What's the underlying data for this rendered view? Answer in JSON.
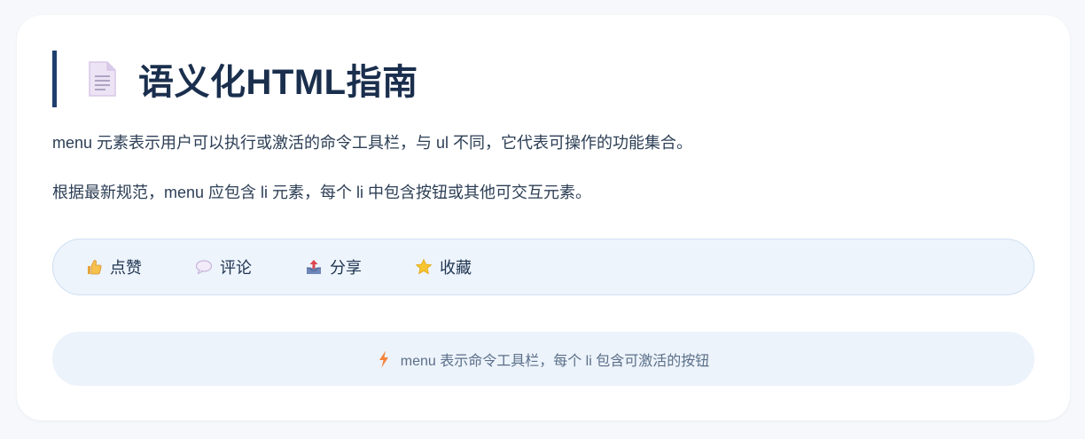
{
  "header": {
    "icon": "document-icon",
    "title": "语义化HTML指南"
  },
  "content": {
    "paragraph_1": "menu 元素表示用户可以执行或激活的命令工具栏，与 ul 不同，它代表可操作的功能集合。",
    "paragraph_2": "根据最新规范，menu 应包含 li 元素，每个 li 中包含按钮或其他可交互元素。"
  },
  "menu": {
    "items": [
      {
        "icon": "thumbs-up-icon",
        "label": "点赞"
      },
      {
        "icon": "speech-bubble-icon",
        "label": "评论"
      },
      {
        "icon": "outbox-tray-icon",
        "label": "分享"
      },
      {
        "icon": "star-icon",
        "label": "收藏"
      }
    ]
  },
  "note": {
    "icon": "lightning-icon",
    "text": "menu 表示命令工具栏，每个 li 包含可激活的按钮"
  },
  "colors": {
    "accent": "#1e3f6e",
    "title": "#1a2f4d",
    "menu_bg": "#edf4fc",
    "note_bg": "#edf3fb"
  }
}
